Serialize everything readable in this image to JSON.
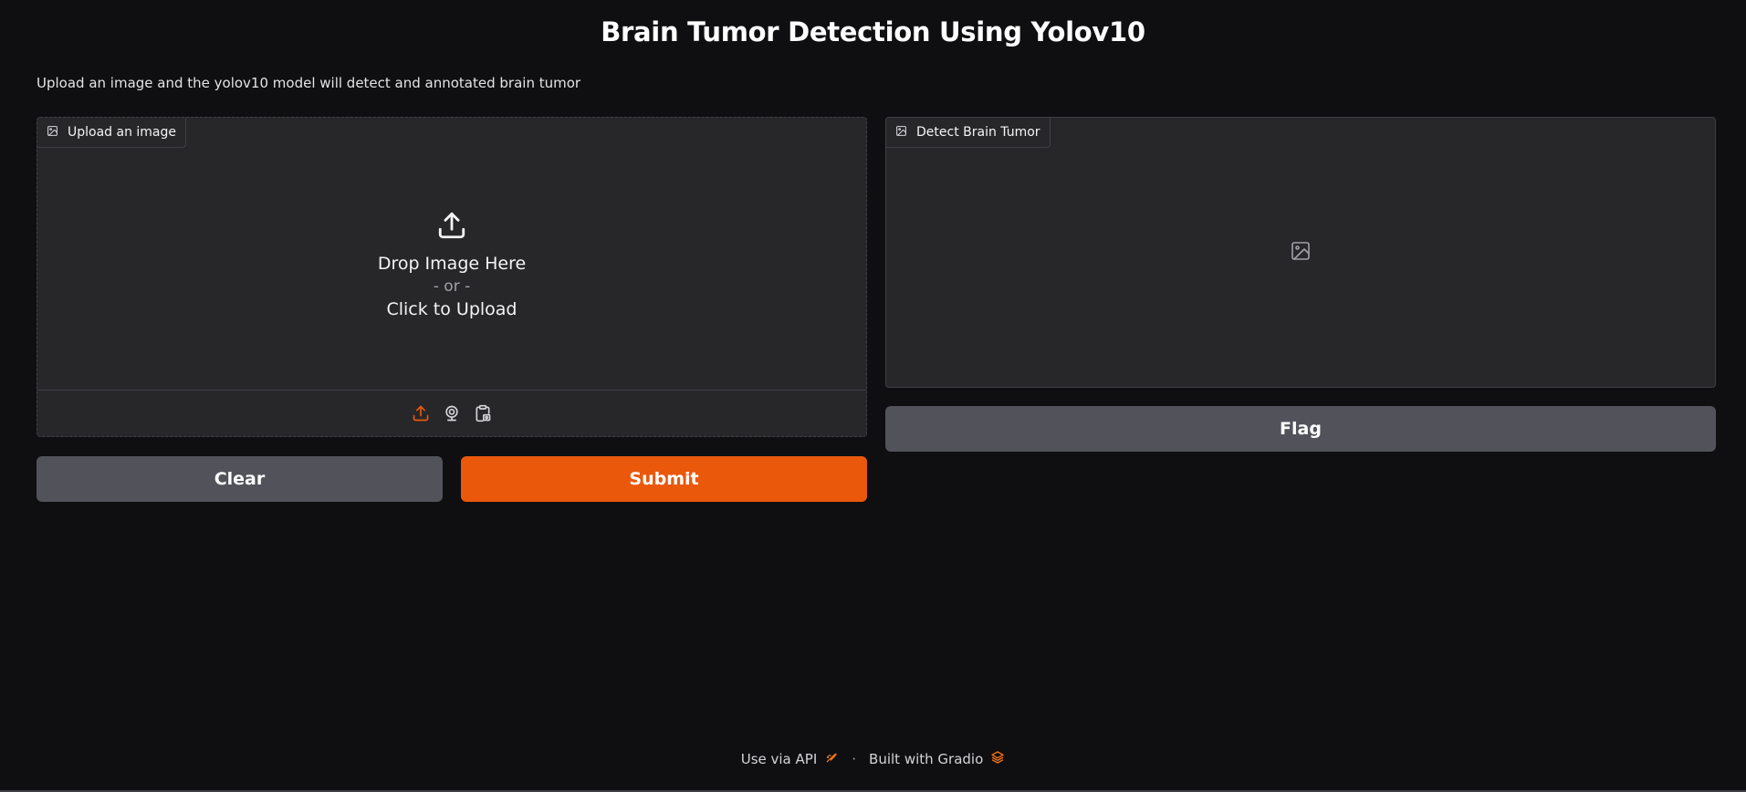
{
  "header": {
    "title": "Brain Tumor Detection Using Yolov10",
    "description": "Upload an image and the yolov10 model will detect and annotated brain tumor"
  },
  "input_panel": {
    "label": "Upload an image",
    "drop_text": "Drop Image Here",
    "or_text": "- or -",
    "click_text": "Click to Upload",
    "sources": [
      "upload-icon",
      "webcam-icon",
      "clipboard-icon"
    ]
  },
  "output_panel": {
    "label": "Detect Brain Tumor"
  },
  "buttons": {
    "clear": "Clear",
    "submit": "Submit",
    "flag": "Flag"
  },
  "footer": {
    "api_text": "Use via API",
    "separator": "·",
    "built_text": "Built with Gradio"
  },
  "colors": {
    "background": "#0f0f11",
    "panel": "#27272a",
    "accent": "#ea580c",
    "secondary_button": "#52525b"
  }
}
